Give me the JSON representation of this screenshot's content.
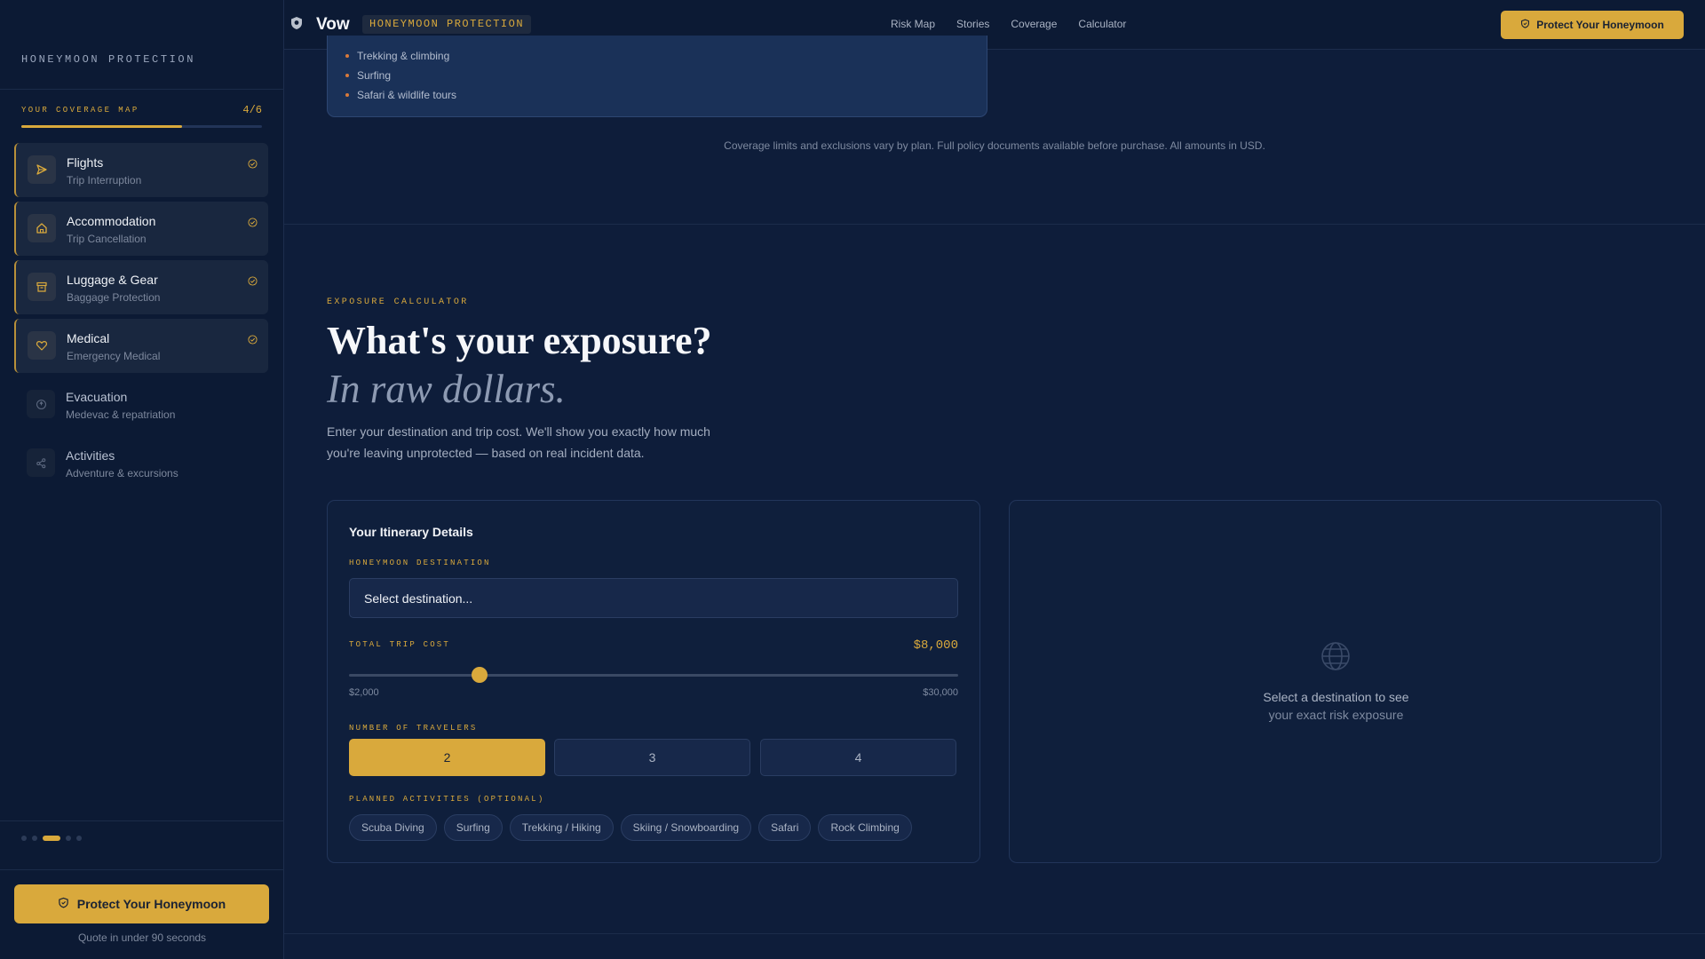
{
  "nav": {
    "brand": "Vow",
    "badge": "HONEYMOON PROTECTION",
    "links": [
      "Risk Map",
      "Stories",
      "Coverage",
      "Calculator"
    ],
    "cta": "Protect Your Honeymoon"
  },
  "sidebar": {
    "brand_label": "HONEYMOON PROTECTION",
    "map_title": "YOUR COVERAGE MAP",
    "map_count": "4/6",
    "progress_fraction": 0.667,
    "items": [
      {
        "title": "Flights",
        "subtitle": "Trip Interruption",
        "icon": "plane-icon",
        "covered": true
      },
      {
        "title": "Accommodation",
        "subtitle": "Trip Cancellation",
        "icon": "home-icon",
        "covered": true
      },
      {
        "title": "Luggage & Gear",
        "subtitle": "Baggage Protection",
        "icon": "archive-icon",
        "covered": true
      },
      {
        "title": "Medical",
        "subtitle": "Emergency Medical",
        "icon": "heart-icon",
        "covered": true
      },
      {
        "title": "Evacuation",
        "subtitle": "Medevac & repatriation",
        "icon": "compass-icon",
        "covered": false
      },
      {
        "title": "Activities",
        "subtitle": "Adventure & excursions",
        "icon": "activity-icon",
        "covered": false
      }
    ],
    "dots_active_index": 2,
    "cta": "Protect Your Honeymoon",
    "cta_note": "Quote in under 90 seconds"
  },
  "activities_card": {
    "items": [
      "Trekking & climbing",
      "Surfing",
      "Safari & wildlife tours"
    ]
  },
  "disclaimer": "Coverage limits and exclusions vary by plan. Full policy documents available before purchase. All amounts in USD.",
  "calculator": {
    "eyebrow": "EXPOSURE CALCULATOR",
    "heading": "What's your exposure?",
    "heading_italic": "In raw dollars.",
    "lead": "Enter your destination and trip cost. We'll show you exactly how much you're leaving unprotected — based on real incident data.",
    "form": {
      "title": "Your Itinerary Details",
      "destination_label": "HONEYMOON DESTINATION",
      "destination_value": "Select destination...",
      "cost_label": "TOTAL TRIP COST",
      "cost_value": "$8,000",
      "cost_min": "$2,000",
      "cost_max": "$30,000",
      "cost_fraction": 0.214,
      "travelers_label": "NUMBER OF TRAVELERS",
      "travelers_options": [
        "2",
        "3",
        "4"
      ],
      "travelers_selected": "2",
      "activities_label": "PLANNED ACTIVITIES (OPTIONAL)",
      "activities": [
        "Scuba Diving",
        "Surfing",
        "Trekking / Hiking",
        "Skiing / Snowboarding",
        "Safari",
        "Rock Climbing"
      ]
    },
    "result": {
      "icon": "globe-icon",
      "line1": "Select a destination to see",
      "line2": "your exact risk exposure"
    }
  },
  "colors": {
    "accent": "#d9a93c",
    "background": "#0e1d3a",
    "sidebar": "#0c1a34"
  }
}
